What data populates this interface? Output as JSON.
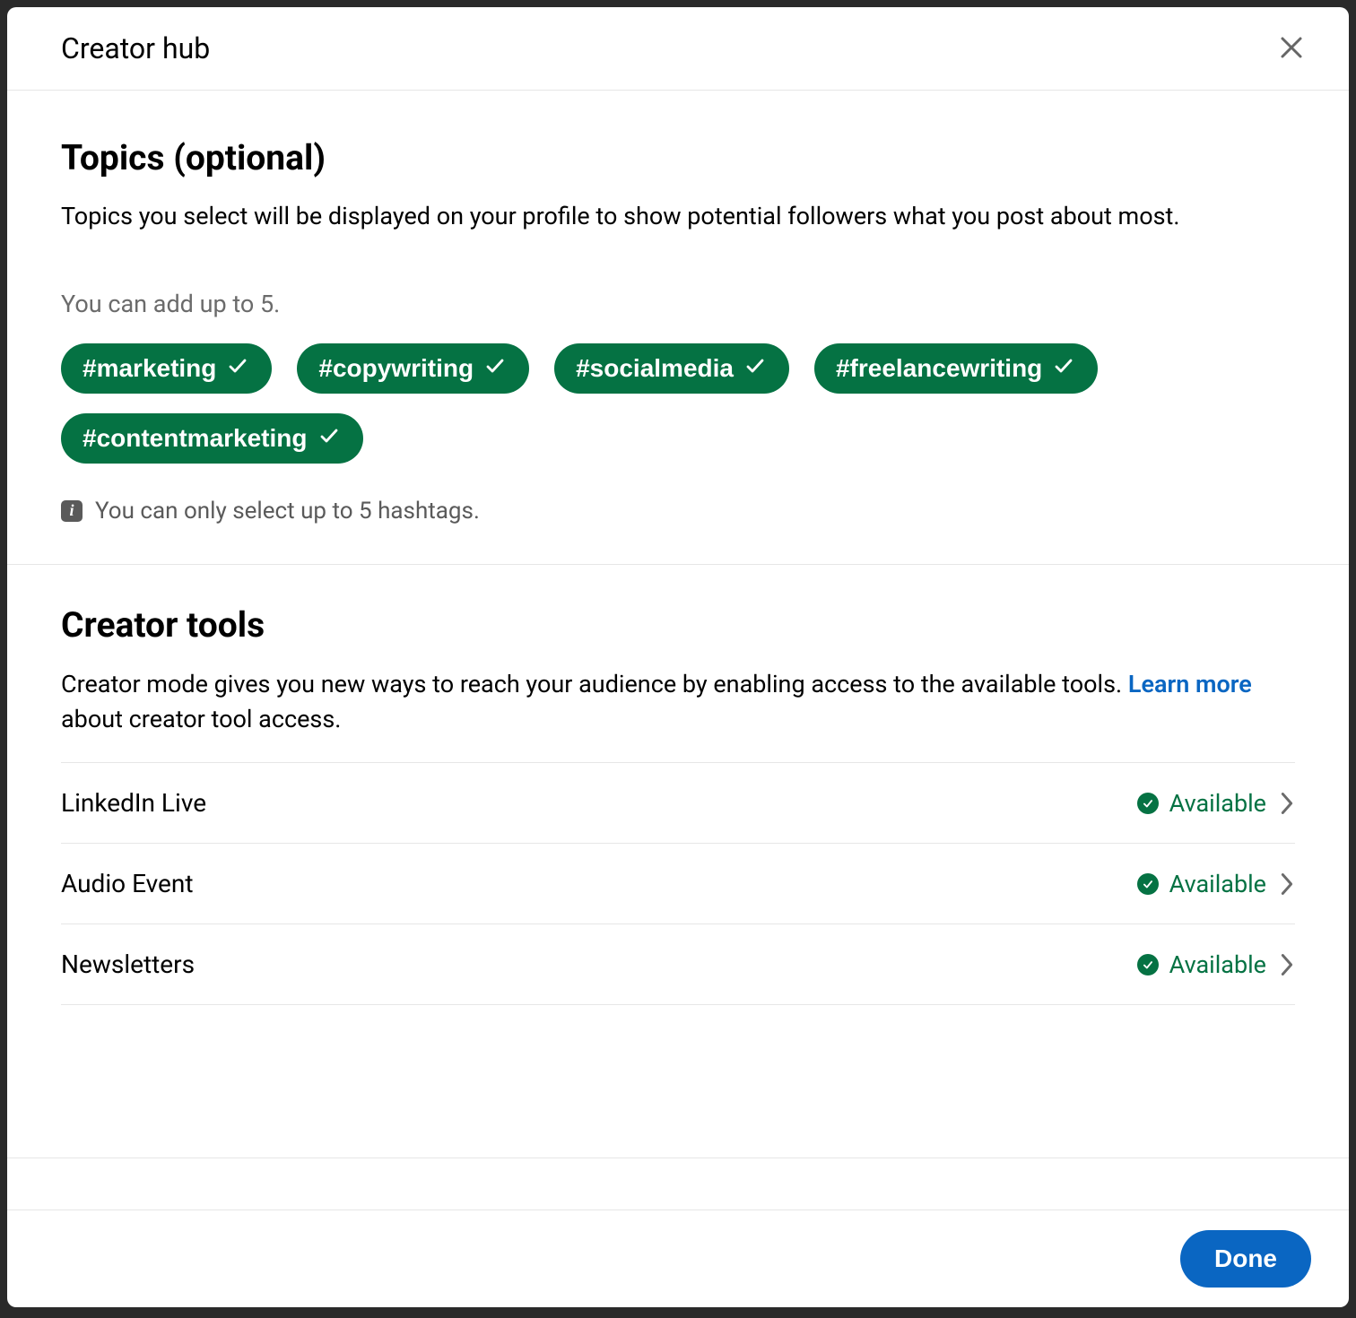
{
  "header": {
    "title": "Creator hub"
  },
  "topics": {
    "heading": "Topics (optional)",
    "description": "Topics you select will be displayed on your profile to show potential followers what you post about most.",
    "helper": "You can add up to 5.",
    "chips": [
      {
        "label": "#marketing"
      },
      {
        "label": "#copywriting"
      },
      {
        "label": "#socialmedia"
      },
      {
        "label": "#freelancewriting"
      },
      {
        "label": "#contentmarketing"
      }
    ],
    "limit_message": "You can only select up to 5 hashtags."
  },
  "tools": {
    "heading": "Creator tools",
    "desc_prefix": "Creator mode gives you new ways to reach your audience by enabling access to the available tools. ",
    "link_label": "Learn more",
    "desc_suffix": " about creator tool access.",
    "items": [
      {
        "name": "LinkedIn Live",
        "status": "Available"
      },
      {
        "name": "Audio Event",
        "status": "Available"
      },
      {
        "name": "Newsletters",
        "status": "Available"
      }
    ]
  },
  "footer": {
    "done_label": "Done"
  }
}
